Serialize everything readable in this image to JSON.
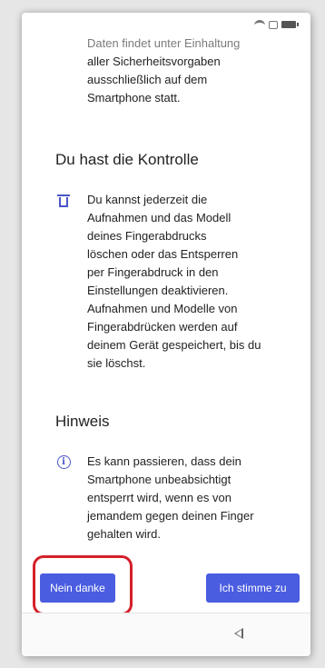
{
  "intro": {
    "lines": [
      "Daten findet unter Einhaltung",
      "aller Sicherheitsvorgaben",
      "ausschließlich auf dem",
      "Smartphone statt."
    ]
  },
  "control_section": {
    "title": "Du hast die Kontrolle",
    "icon": "trash-icon",
    "lines": [
      "Du kannst jederzeit die",
      "Aufnahmen und das Modell",
      "deines Fingerabdrucks",
      "löschen oder das Entsperren",
      "per Fingerabdruck in den",
      "Einstellungen deaktivieren.",
      "Aufnahmen und Modelle von",
      "Fingerabdrücken werden auf",
      "deinem Gerät gespeichert, bis du",
      "sie löschst."
    ]
  },
  "note_section": {
    "title": "Hinweis",
    "icon": "info-icon",
    "lines": [
      "Es kann passieren, dass dein",
      "Smartphone unbeabsichtigt",
      "entsperrt wird, wenn es von",
      "jemandem gegen deinen Finger",
      "gehalten wird."
    ]
  },
  "buttons": {
    "decline": "Nein danke",
    "accept": "Ich stimme zu"
  },
  "colors": {
    "accent": "#4a5de0",
    "highlight": "#d4202a"
  }
}
